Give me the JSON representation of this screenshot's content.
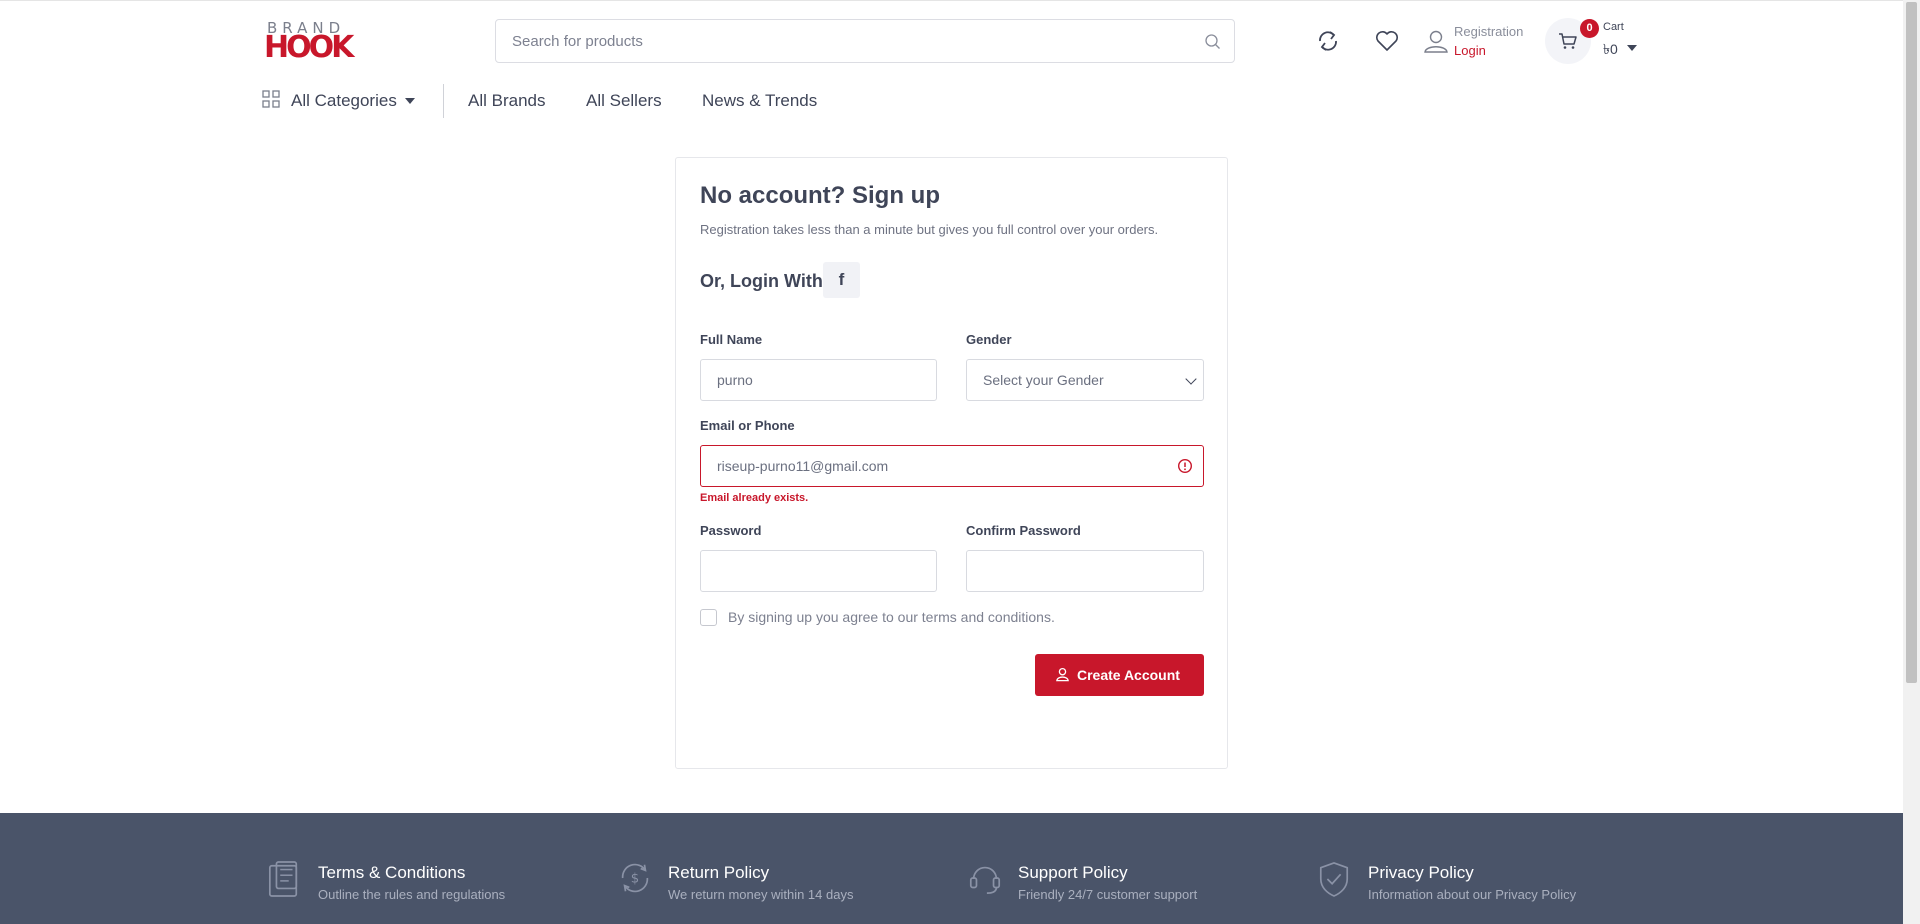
{
  "header": {
    "logo_top": "BRAND",
    "logo_bottom": "HOOK",
    "search_placeholder": "Search for products",
    "registration_label": "Registration",
    "login_label": "Login",
    "cart_count": "0",
    "cart_label": "Cart",
    "cart_amount": "৳0"
  },
  "nav": {
    "categories_label": "All Categories",
    "links": [
      "All Brands",
      "All Sellers",
      "News & Trends"
    ]
  },
  "signup": {
    "title": "No account? Sign up",
    "subtitle": "Registration takes less than a minute but gives you full control over your orders.",
    "or_login_with": "Or, Login With",
    "facebook_letter": "f",
    "full_name_label": "Full Name",
    "full_name_value": "purno",
    "gender_label": "Gender",
    "gender_selected": "Select your Gender",
    "email_label": "Email or Phone",
    "email_value": "riseup-purno11@gmail.com",
    "email_error": "Email already exists.",
    "password_label": "Password",
    "confirm_password_label": "Confirm Password",
    "terms_text": "By signing up you agree to our terms and conditions.",
    "create_button": "Create Account"
  },
  "footer": {
    "policies": [
      {
        "title": "Terms & Conditions",
        "desc": "Outline the rules and regulations",
        "icon": "document-icon"
      },
      {
        "title": "Return Policy",
        "desc": "We return money within 14 days",
        "icon": "money-return-icon"
      },
      {
        "title": "Support Policy",
        "desc": "Friendly 24/7 customer support",
        "icon": "headset-icon"
      },
      {
        "title": "Privacy Policy",
        "desc": "Information about our Privacy Policy",
        "icon": "shield-check-icon"
      }
    ]
  },
  "colors": {
    "brand_red": "#c8172b",
    "text_dark": "#3f4558",
    "footer_bg": "#4a5469"
  }
}
